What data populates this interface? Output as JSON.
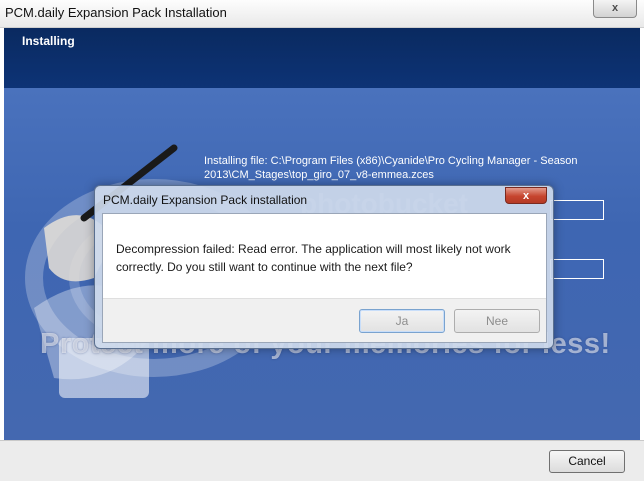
{
  "window": {
    "title": "PCM.daily Expansion Pack Installation",
    "close_glyph": "x"
  },
  "header": {
    "title": "Installing"
  },
  "content": {
    "install_path": "Installing file: C:\\Program Files (x86)\\Cyanide\\Pro Cycling Manager - Season 2013\\CM_Stages\\top_giro_07_v8-emmea.zces",
    "watermark_text": "Protect more of your memories for less!",
    "watermark_logo": "photobucket"
  },
  "footer": {
    "cancel_label": "Cancel"
  },
  "dialog": {
    "title": "PCM.daily Expansion Pack installation",
    "close_glyph": "x",
    "message": "Decompression failed: Read error. The application will most likely not work correctly. Do you still want to continue with the next file?",
    "yes_label": "Ja",
    "no_label": "Nee"
  },
  "colors": {
    "header_band": "#0d3376",
    "content_bg": "#4468b0",
    "dialog_close": "#c6452f"
  }
}
